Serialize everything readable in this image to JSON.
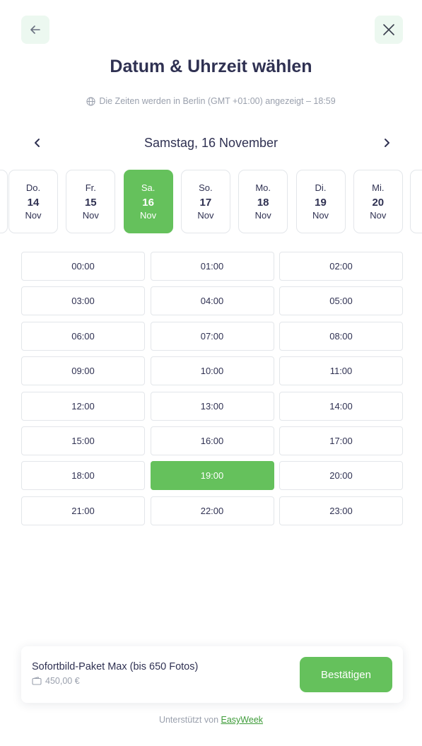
{
  "header": {
    "back_icon": "arrow-left-icon",
    "close_icon": "close-icon",
    "title": "Datum & Uhrzeit wählen",
    "timezone_icon": "globe-icon",
    "timezone_text": "Die Zeiten werden in Berlin (GMT +01:00) angezeigt – 18:59"
  },
  "date_nav": {
    "current": "Samstag, 16 November",
    "prev_icon": "chevron-left-icon",
    "next_icon": "chevron-right-icon"
  },
  "days": [
    {
      "name": "Do.",
      "num": "14",
      "mon": "Nov",
      "selected": false
    },
    {
      "name": "Fr.",
      "num": "15",
      "mon": "Nov",
      "selected": false
    },
    {
      "name": "Sa.",
      "num": "16",
      "mon": "Nov",
      "selected": true
    },
    {
      "name": "So.",
      "num": "17",
      "mon": "Nov",
      "selected": false
    },
    {
      "name": "Mo.",
      "num": "18",
      "mon": "Nov",
      "selected": false
    },
    {
      "name": "Di.",
      "num": "19",
      "mon": "Nov",
      "selected": false
    },
    {
      "name": "Mi.",
      "num": "20",
      "mon": "Nov",
      "selected": false
    }
  ],
  "slots": [
    "00:00",
    "01:00",
    "02:00",
    "03:00",
    "04:00",
    "05:00",
    "06:00",
    "07:00",
    "08:00",
    "09:00",
    "10:00",
    "11:00",
    "12:00",
    "13:00",
    "14:00",
    "15:00",
    "16:00",
    "17:00",
    "18:00",
    "19:00",
    "20:00",
    "21:00",
    "22:00",
    "23:00"
  ],
  "selected_slot": "19:00",
  "summary": {
    "service": "Sofortbild-Paket Max (bis 650 Fotos)",
    "price_icon": "wallet-icon",
    "price": "450,00 €",
    "confirm_label": "Bestätigen"
  },
  "footer": {
    "text": "Unterstützt von",
    "link": "EasyWeek"
  },
  "colors": {
    "accent": "#65c15c",
    "text": "#2f3152",
    "muted": "#9aa0ad",
    "icon_bg": "#ecf8f0",
    "link": "#3e9b39"
  }
}
